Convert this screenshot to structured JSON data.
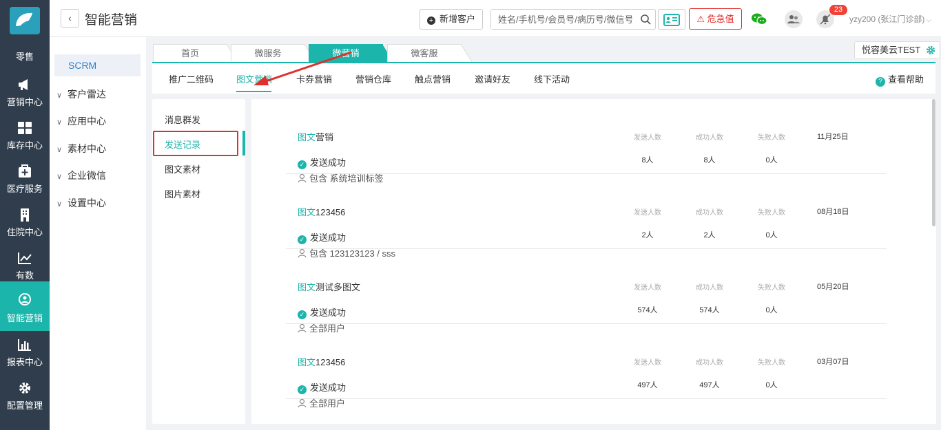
{
  "nav": {
    "items": [
      {
        "label": "零售",
        "icon": "retail-icon"
      },
      {
        "label": "营销中心",
        "icon": "megaphone-icon"
      },
      {
        "label": "库存中心",
        "icon": "grid-icon"
      },
      {
        "label": "医疗服务",
        "icon": "medical-kit-icon"
      },
      {
        "label": "住院中心",
        "icon": "building-icon"
      },
      {
        "label": "有数",
        "icon": "trend-icon"
      },
      {
        "label": "智能营销",
        "icon": "smart-marketing-icon"
      },
      {
        "label": "报表中心",
        "icon": "bar-chart-icon"
      },
      {
        "label": "配置管理",
        "icon": "gear-icon"
      }
    ],
    "active_index": 6
  },
  "header": {
    "title": "智能营销",
    "new_customer": "新增客户",
    "search_placeholder": "姓名/手机号/会员号/病历号/微信号",
    "danger_label": "危急值",
    "badge_count": "23",
    "user": "yzy200 (张江门诊部)"
  },
  "sidebar2": {
    "top": "SCRM",
    "groups": [
      "客户雷达",
      "应用中心",
      "素材中心",
      "企业微信",
      "设置中心"
    ]
  },
  "tabs": {
    "items": [
      "首页",
      "微服务",
      "微营销",
      "微客服"
    ],
    "active_index": 2,
    "tenant": "悦容美云TEST"
  },
  "subnav": {
    "items": [
      "推广二维码",
      "图文营销",
      "卡券营销",
      "营销仓库",
      "触点营销",
      "邀请好友",
      "线下活动"
    ],
    "active_index": 1,
    "help": "查看帮助"
  },
  "menu": {
    "items": [
      "消息群发",
      "发送记录",
      "图文素材",
      "图片素材"
    ],
    "active_index": 1
  },
  "records": {
    "col_sent": "发送人数",
    "col_success": "成功人数",
    "col_fail": "失败人数",
    "items": [
      {
        "kind": "图文",
        "title": "营销",
        "status": "发送成功",
        "target": "包含 系统培训标签",
        "sent": "8人",
        "success": "8人",
        "fail": "0人",
        "date": "11月25日"
      },
      {
        "kind": "图文",
        "title": "123456",
        "status": "发送成功",
        "target": "包含 123123123 / sss",
        "sent": "2人",
        "success": "2人",
        "fail": "0人",
        "date": "08月18日"
      },
      {
        "kind": "图文",
        "title": "测试多图文",
        "status": "发送成功",
        "target": "全部用户",
        "sent": "574人",
        "success": "574人",
        "fail": "0人",
        "date": "05月20日"
      },
      {
        "kind": "图文",
        "title": "123456",
        "status": "发送成功",
        "target": "全部用户",
        "sent": "497人",
        "success": "497人",
        "fail": "0人",
        "date": "03月07日"
      }
    ]
  },
  "colors": {
    "accent": "#1cb5ab",
    "nav_bg": "#2f3d4c",
    "danger": "#e0302b"
  }
}
